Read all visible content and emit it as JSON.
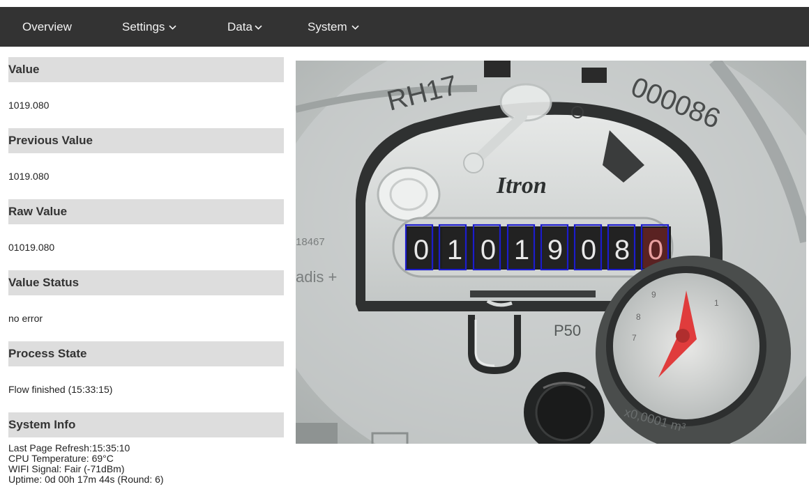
{
  "nav": {
    "items": [
      {
        "label": "Overview",
        "dropdown": false
      },
      {
        "label": "Settings",
        "dropdown": true
      },
      {
        "label": "Data",
        "dropdown": true
      },
      {
        "label": "System",
        "dropdown": true
      }
    ]
  },
  "sections": {
    "value": {
      "title": "Value",
      "text": "1019.080"
    },
    "previous_value": {
      "title": "Previous Value",
      "text": "1019.080"
    },
    "raw_value": {
      "title": "Raw Value",
      "text": "01019.080"
    },
    "value_status": {
      "title": "Value Status",
      "text": "no error"
    },
    "process_state": {
      "title": "Process State",
      "text": "Flow finished (15:33:15)"
    },
    "system_info": {
      "title": "System Info",
      "lines": [
        "Last Page Refresh:15:35:10",
        "CPU Temperature: 69°C",
        "WIFI Signal: Fair (-71dBm)",
        "Uptime: 0d 00h 17m 44s (Round: 6)"
      ]
    }
  },
  "meter_image": {
    "printed_text": {
      "model": "RH17",
      "serial": "000086",
      "brand": "Itron",
      "side_number": "18467",
      "side_text": "adis +",
      "label_p50": "P50",
      "dial_scale": "x0,0001 m³"
    },
    "digits": [
      "0",
      "1",
      "0",
      "1",
      "9",
      "0",
      "8",
      "0"
    ],
    "colors": {
      "roi_box": "#1c1ccc",
      "dial_pointer": "#e03c3c",
      "last_digit": "#9e3b3b"
    }
  },
  "colors": {
    "navbar_bg": "#333333",
    "navbar_text": "#f2f2f2",
    "section_header_bg": "#dddddd"
  }
}
